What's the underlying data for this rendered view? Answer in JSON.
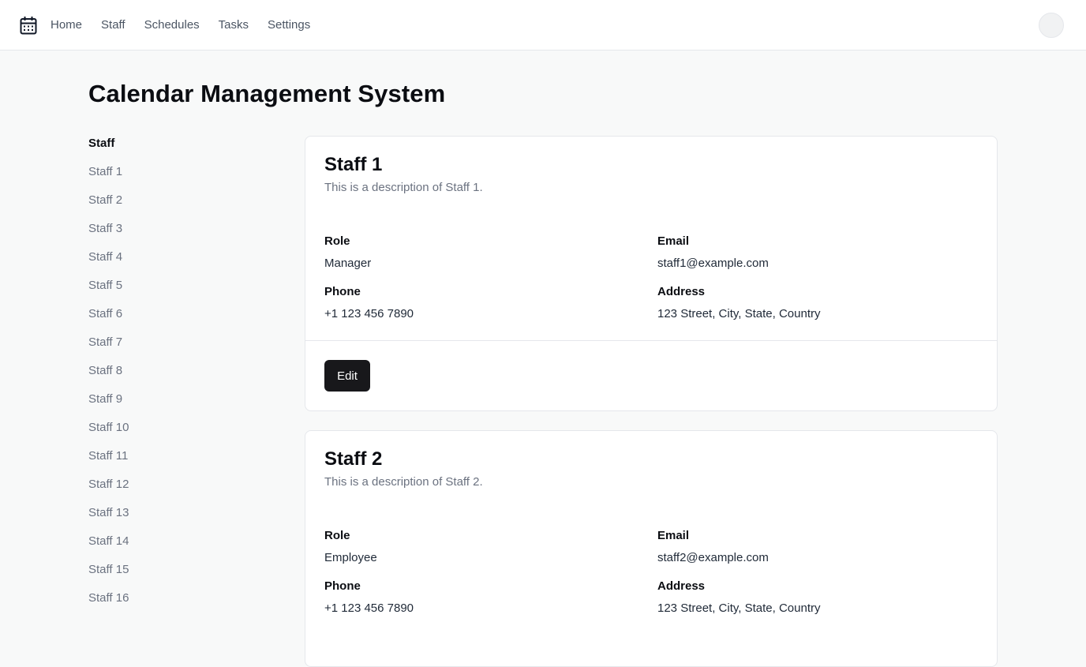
{
  "nav": {
    "logo_icon": "calendar-icon",
    "items": [
      {
        "label": "Home"
      },
      {
        "label": "Staff"
      },
      {
        "label": "Schedules"
      },
      {
        "label": "Tasks"
      },
      {
        "label": "Settings"
      }
    ]
  },
  "page": {
    "title": "Calendar Management System"
  },
  "sidebar": {
    "heading": "Staff",
    "items": [
      {
        "label": "Staff 1"
      },
      {
        "label": "Staff 2"
      },
      {
        "label": "Staff 3"
      },
      {
        "label": "Staff 4"
      },
      {
        "label": "Staff 5"
      },
      {
        "label": "Staff 6"
      },
      {
        "label": "Staff 7"
      },
      {
        "label": "Staff 8"
      },
      {
        "label": "Staff 9"
      },
      {
        "label": "Staff 10"
      },
      {
        "label": "Staff 11"
      },
      {
        "label": "Staff 12"
      },
      {
        "label": "Staff 13"
      },
      {
        "label": "Staff 14"
      },
      {
        "label": "Staff 15"
      },
      {
        "label": "Staff 16"
      }
    ]
  },
  "labels": {
    "role": "Role",
    "email": "Email",
    "phone": "Phone",
    "address": "Address",
    "edit": "Edit"
  },
  "staff_cards": [
    {
      "title": "Staff 1",
      "description": "This is a description of Staff 1.",
      "role": "Manager",
      "email": "staff1@example.com",
      "phone": "+1 123 456 7890",
      "address": "123 Street, City, State, Country"
    },
    {
      "title": "Staff 2",
      "description": "This is a description of Staff 2.",
      "role": "Employee",
      "email": "staff2@example.com",
      "phone": "+1 123 456 7890",
      "address": "123 Street, City, State, Country"
    }
  ],
  "colors": {
    "button_bg": "#18181b",
    "page_bg": "#f8f9f9",
    "muted_text": "#6b7280"
  }
}
